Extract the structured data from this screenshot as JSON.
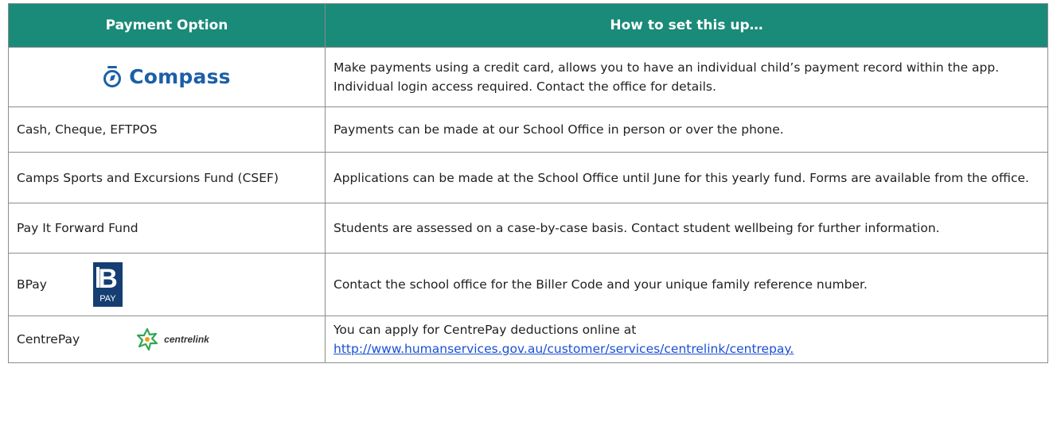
{
  "table": {
    "header": {
      "col1": "Payment Option",
      "col2": "How to set this up…"
    },
    "rows": [
      {
        "option": "",
        "logo_text": "Compass",
        "logo_icon": "compass-logo-icon",
        "description": "Make payments using a credit card, allows you to have an individual child’s payment record within the app. Individual login access required. Contact the office for details."
      },
      {
        "option": "Cash, Cheque, EFTPOS",
        "description": "Payments can be made at our School Office in person or over the phone."
      },
      {
        "option": "Camps Sports and Excursions Fund (CSEF)",
        "description": "Applications can be made at the School Office until June for this yearly fund.  Forms are available from the office."
      },
      {
        "option": "Pay It Forward Fund",
        "description": "Students are assessed on a case-by-case basis.  Contact student wellbeing for further information."
      },
      {
        "option": "BPay",
        "logo_text": "PAY",
        "logo_icon": "bpay-logo-icon",
        "description": "Contact the school office for the Biller Code and your unique family reference number."
      },
      {
        "option": "CentrePay",
        "logo_text": "centrelink",
        "logo_icon": "centrelink-logo-icon",
        "description": "You can apply for CentrePay deductions online at",
        "link": "http://www.humanservices.gov.au/customer/services/centrelink/centrepay."
      }
    ]
  },
  "colors": {
    "header_bg": "#1a8a79",
    "compass_blue": "#1c5fa8",
    "bpay_navy": "#153e72",
    "link_blue": "#1a4fd6"
  }
}
